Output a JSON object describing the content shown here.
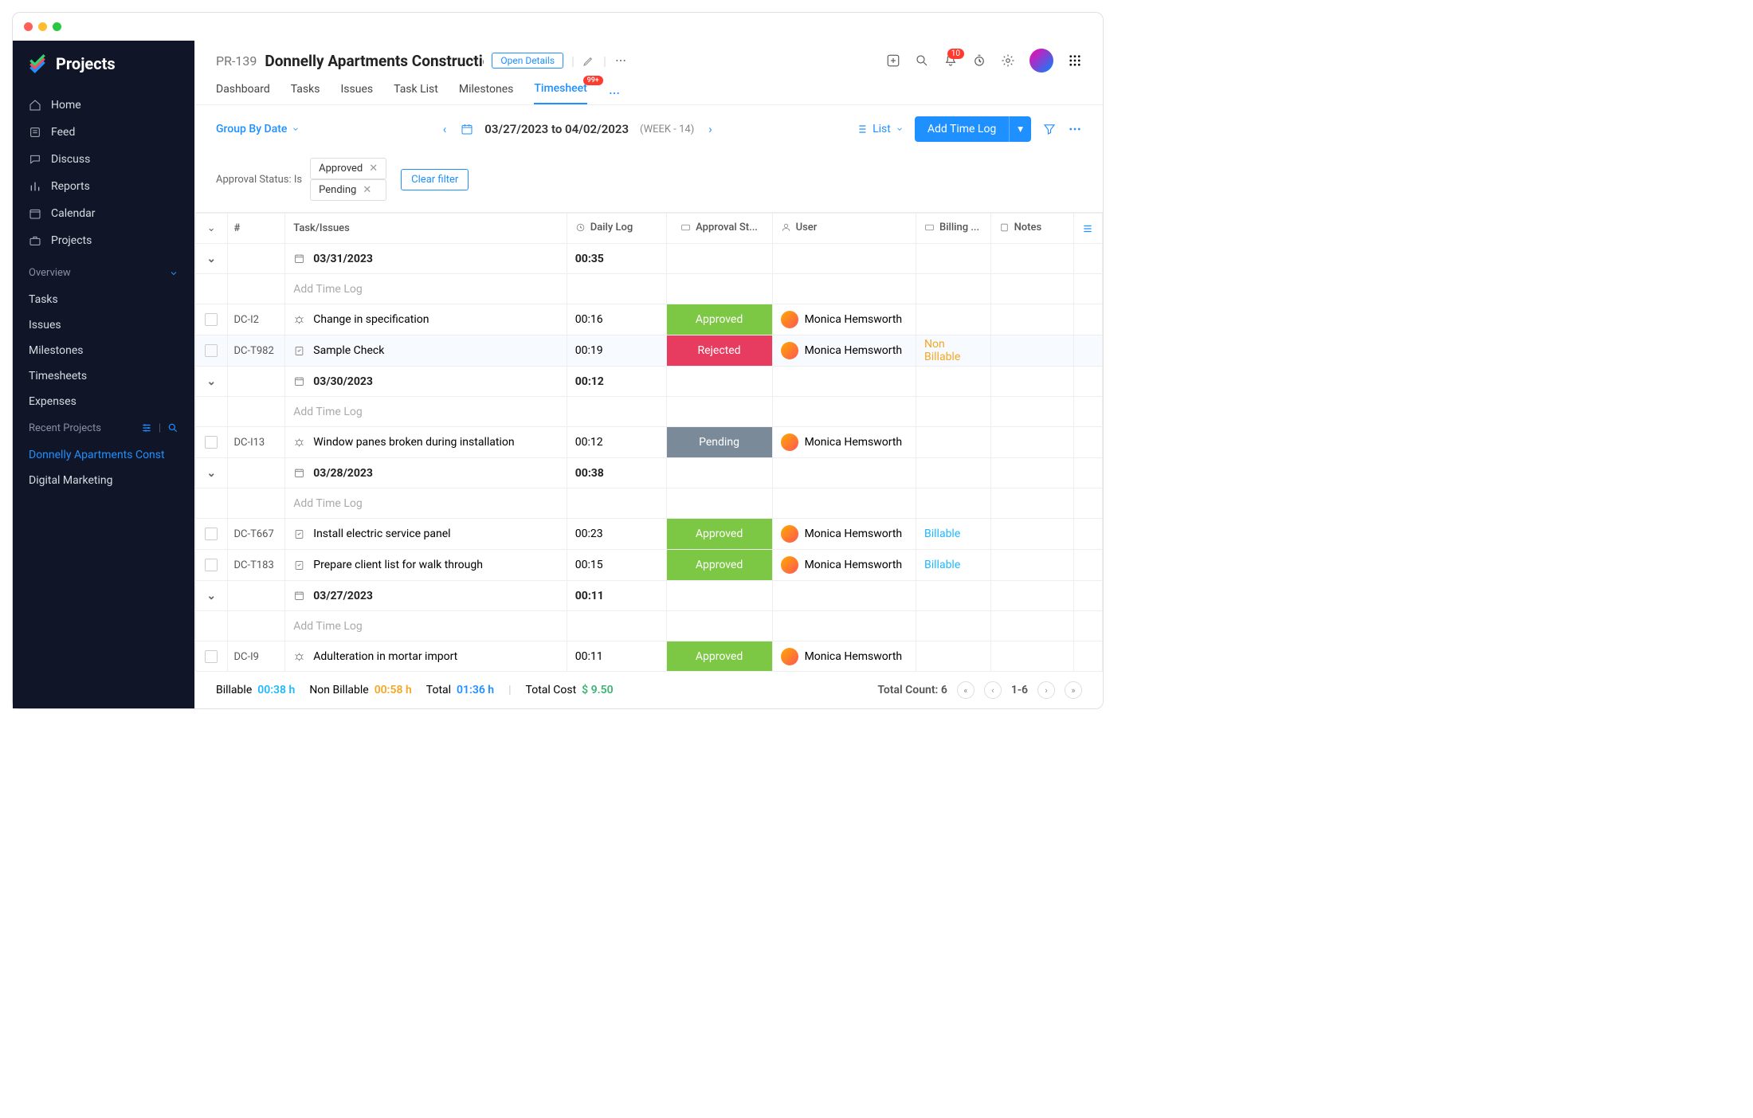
{
  "brand": "Projects",
  "sidebar": {
    "main": [
      {
        "icon": "home",
        "label": "Home"
      },
      {
        "icon": "feed",
        "label": "Feed"
      },
      {
        "icon": "chat",
        "label": "Discuss"
      },
      {
        "icon": "report",
        "label": "Reports"
      },
      {
        "icon": "calendar",
        "label": "Calendar"
      },
      {
        "icon": "briefcase",
        "label": "Projects"
      }
    ],
    "overview_label": "Overview",
    "overview": [
      "Tasks",
      "Issues",
      "Milestones",
      "Timesheets",
      "Expenses"
    ],
    "recent_label": "Recent Projects",
    "recent": [
      {
        "label": "Donnelly Apartments Const",
        "active": true
      },
      {
        "label": "Digital Marketing",
        "active": false
      }
    ]
  },
  "header": {
    "project_id": "PR-139",
    "project_name": "Donnelly Apartments Constructic",
    "open_details": "Open Details",
    "bell_badge": "10",
    "tabs": [
      "Dashboard",
      "Tasks",
      "Issues",
      "Task List",
      "Milestones",
      "Timesheet"
    ],
    "active_tab": "Timesheet",
    "timesheet_badge": "99+"
  },
  "toolbar": {
    "group_by": "Group By Date",
    "range": "03/27/2023 to 04/02/2023",
    "week": "(WEEK - 14)",
    "view": "List",
    "add": "Add Time Log"
  },
  "filters": {
    "label": "Approval Status: Is",
    "chips": [
      "Approved",
      "Pending"
    ],
    "clear": "Clear filter"
  },
  "columns": {
    "num": "#",
    "task": "Task/Issues",
    "log": "Daily Log",
    "status": "Approval St...",
    "user": "User",
    "bill": "Billing ...",
    "notes": "Notes"
  },
  "addTimeLog": "Add Time Log",
  "rows": [
    {
      "type": "date",
      "date": "03/31/2023",
      "log": "00:35"
    },
    {
      "type": "add"
    },
    {
      "type": "entry",
      "id": "DC-I2",
      "icon": "bug",
      "task": "Change in specification",
      "log": "00:16",
      "status": "Approved",
      "statusClass": "approved",
      "user": "Monica Hemsworth",
      "bill": ""
    },
    {
      "type": "entry",
      "id": "DC-T982",
      "icon": "task",
      "task": "Sample Check",
      "log": "00:19",
      "status": "Rejected",
      "statusClass": "rejected",
      "user": "Monica Hemsworth",
      "bill": "Non Billable",
      "hl": true
    },
    {
      "type": "date",
      "date": "03/30/2023",
      "log": "00:12"
    },
    {
      "type": "add"
    },
    {
      "type": "entry",
      "id": "DC-I13",
      "icon": "bug",
      "task": "Window panes broken during installation",
      "log": "00:12",
      "status": "Pending",
      "statusClass": "pending",
      "user": "Monica Hemsworth",
      "bill": ""
    },
    {
      "type": "date",
      "date": "03/28/2023",
      "log": "00:38"
    },
    {
      "type": "add"
    },
    {
      "type": "entry",
      "id": "DC-T667",
      "icon": "task",
      "task": "Install electric service panel",
      "log": "00:23",
      "status": "Approved",
      "statusClass": "approved",
      "user": "Monica Hemsworth",
      "bill": "Billable"
    },
    {
      "type": "entry",
      "id": "DC-T183",
      "icon": "task",
      "task": "Prepare client list for walk through",
      "log": "00:15",
      "status": "Approved",
      "statusClass": "approved",
      "user": "Monica Hemsworth",
      "bill": "Billable"
    },
    {
      "type": "date",
      "date": "03/27/2023",
      "log": "00:11"
    },
    {
      "type": "add"
    },
    {
      "type": "entry",
      "id": "DC-I9",
      "icon": "bug",
      "task": "Adulteration in mortar import",
      "log": "00:11",
      "status": "Approved",
      "statusClass": "approved",
      "user": "Monica Hemsworth",
      "bill": ""
    }
  ],
  "footer": {
    "billable_lbl": "Billable",
    "billable": "00:38 h",
    "nonbillable_lbl": "Non Billable",
    "nonbillable": "00:58 h",
    "total_lbl": "Total",
    "total": "01:36 h",
    "cost_lbl": "Total Cost",
    "cost": "$ 9.50",
    "count_lbl": "Total Count: 6",
    "range": "1-6"
  }
}
